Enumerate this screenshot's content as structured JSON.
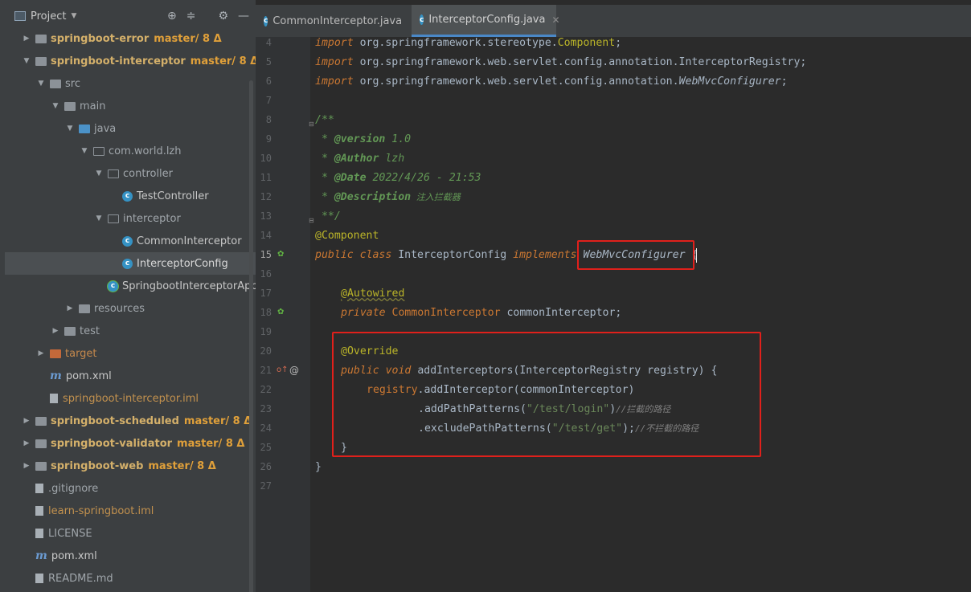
{
  "project_header": {
    "title": "Project"
  },
  "tree": [
    {
      "label": "springboot-error",
      "branch": "master/ 8 Δ",
      "kind": "module"
    },
    {
      "label": "springboot-interceptor",
      "branch": "master/ 8 Δ",
      "kind": "module"
    },
    {
      "label": "src",
      "kind": "folder"
    },
    {
      "label": "main",
      "kind": "folder"
    },
    {
      "label": "java",
      "kind": "folder"
    },
    {
      "label": "com.world.lzh",
      "kind": "package"
    },
    {
      "label": "controller",
      "kind": "package"
    },
    {
      "label": "TestController",
      "kind": "class"
    },
    {
      "label": "interceptor",
      "kind": "package"
    },
    {
      "label": "CommonInterceptor",
      "kind": "class"
    },
    {
      "label": "InterceptorConfig",
      "kind": "class"
    },
    {
      "label": "SpringbootInterceptorApplica",
      "kind": "class"
    },
    {
      "label": "resources",
      "kind": "folder"
    },
    {
      "label": "test",
      "kind": "folder"
    },
    {
      "label": "target",
      "kind": "folder"
    },
    {
      "label": "pom.xml",
      "kind": "maven"
    },
    {
      "label": "springboot-interceptor.iml",
      "kind": "file"
    },
    {
      "label": "springboot-scheduled",
      "branch": "master/ 8 Δ",
      "kind": "module"
    },
    {
      "label": "springboot-validator",
      "branch": "master/ 8 Δ",
      "kind": "module"
    },
    {
      "label": "springboot-web",
      "branch": "master/ 8 Δ",
      "kind": "module"
    },
    {
      "label": ".gitignore",
      "kind": "file"
    },
    {
      "label": "learn-springboot.iml",
      "kind": "file"
    },
    {
      "label": "LICENSE",
      "kind": "file"
    },
    {
      "label": "pom.xml",
      "kind": "maven"
    },
    {
      "label": "README.md",
      "kind": "file"
    }
  ],
  "tabs": [
    {
      "label": "CommonInterceptor.java"
    },
    {
      "label": "InterceptorConfig.java"
    }
  ],
  "line_numbers": [
    "4",
    "5",
    "6",
    "7",
    "8",
    "9",
    "10",
    "11",
    "12",
    "13",
    "14",
    "15",
    "16",
    "17",
    "18",
    "19",
    "20",
    "21",
    "22",
    "23",
    "24",
    "25",
    "26",
    "27"
  ],
  "code": {
    "l4": [
      "import",
      " org.springframework.stereotype.",
      "Component",
      ";"
    ],
    "l5": [
      "import",
      " org.springframework.web.servlet.config.annotation.InterceptorRegistry;"
    ],
    "l6": [
      "import",
      " org.springframework.web.servlet.config.annotation.",
      "WebMvcConfigurer",
      ";"
    ],
    "l8": "/**",
    "l9": [
      " * ",
      "@version",
      " 1.0"
    ],
    "l10": [
      " * ",
      "@Author",
      " lzh"
    ],
    "l11": [
      " * ",
      "@Date",
      " 2022/4/26 - 21:53"
    ],
    "l12": [
      " * ",
      "@Description",
      " 注入拦截器"
    ],
    "l13": " **/",
    "l14": "@Component",
    "l15": [
      "public",
      " ",
      "class",
      " InterceptorConfig ",
      "implements",
      " ",
      "WebMvcConfigurer",
      " {"
    ],
    "l17": "@Autowired",
    "l18": [
      "private",
      " ",
      "CommonInterceptor",
      " commonInterceptor;"
    ],
    "l20": "@Override",
    "l21": [
      "public",
      " ",
      "void",
      " ",
      "addInterceptors",
      "(InterceptorRegistry registry) {"
    ],
    "l22": [
      "registry",
      ".addInterceptor(commonInterceptor)"
    ],
    "l23": [
      ".addPathPatterns(",
      "\"/test/login\"",
      ")",
      "//拦截的路径"
    ],
    "l24": [
      ".excludePathPatterns(",
      "\"/test/get\"",
      ");",
      "//不拦截的路径"
    ],
    "l25": "}",
    "l26": "}"
  }
}
